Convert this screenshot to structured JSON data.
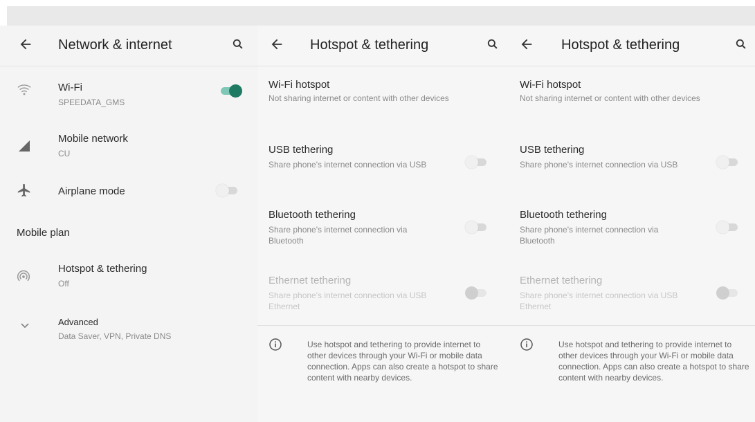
{
  "network": {
    "title": "Network & internet",
    "items": [
      {
        "title": "Wi-Fi",
        "subtitle": "SPEEDATA_GMS"
      },
      {
        "title": "Mobile network",
        "subtitle": "CU"
      },
      {
        "title": "Airplane mode"
      },
      {
        "title": "Hotspot & tethering",
        "subtitle": "Off"
      },
      {
        "title": "Advanced",
        "subtitle": "Data Saver, VPN, Private DNS"
      }
    ],
    "section": "Mobile plan"
  },
  "hotspot_a": {
    "title": "Hotspot & tethering",
    "items": [
      {
        "title": "Wi-Fi hotspot",
        "subtitle": "Not sharing internet or content with other devices"
      },
      {
        "title": "USB tethering",
        "subtitle": "Share phone's internet connection via USB"
      },
      {
        "title": "Bluetooth tethering",
        "subtitle": "Share phone's internet connection via Bluetooth"
      },
      {
        "title": "Ethernet tethering",
        "subtitle": "Share phone's internet connection via USB Ethernet"
      }
    ],
    "info": "Use hotspot and tethering to provide internet to other devices through your Wi-Fi or mobile data connection. Apps can also create a hotspot to share content with nearby devices."
  },
  "hotspot_b": {
    "title": "Hotspot & tethering",
    "items": [
      {
        "title": "Wi-Fi hotspot",
        "subtitle": "Not sharing internet or content with other devices"
      },
      {
        "title": "USB tethering",
        "subtitle": "Share phone's internet connection via USB"
      },
      {
        "title": "Bluetooth tethering",
        "subtitle": "Share phone's internet connection via Bluetooth"
      },
      {
        "title": "Ethernet tethering",
        "subtitle": "Share phone's internet connection via USB Ethernet"
      }
    ],
    "info": "Use hotspot and tethering to provide internet to other devices through your Wi-Fi or mobile data connection. Apps can also create a hotspot to share content with nearby devices."
  },
  "toggles": {
    "wifi": "on",
    "airplane": "off",
    "usb": "off",
    "bluetooth": "off",
    "ethernet": "disabled"
  },
  "colors": {
    "accent": "#1f7a63",
    "accent_track": "#7fc7b6"
  },
  "icons": [
    "back-arrow-icon",
    "search-icon",
    "wifi-icon",
    "signal-icon",
    "airplane-icon",
    "hotspot-icon",
    "chevron-down-icon",
    "info-icon"
  ]
}
